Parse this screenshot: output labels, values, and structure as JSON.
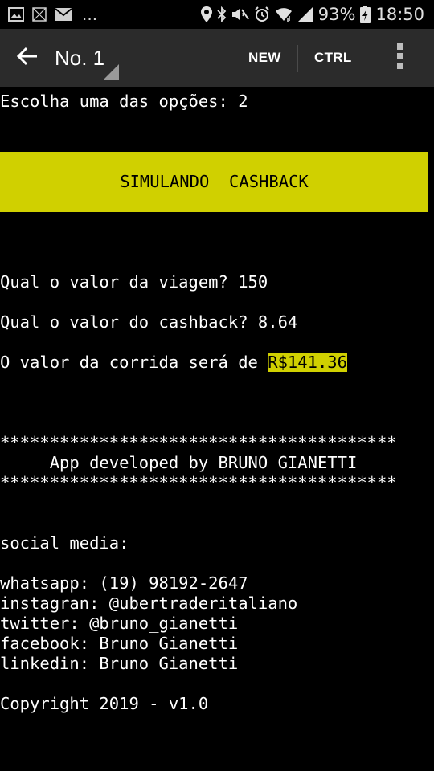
{
  "status_bar": {
    "battery": "93%",
    "time": "18:50",
    "overflow": "...",
    "left_icons": [
      "image-notification-icon",
      "grid-notification-icon",
      "mail-notification-icon"
    ],
    "right_icons": [
      "location-icon",
      "bluetooth-icon",
      "mute-icon",
      "alarm-icon",
      "wifi-icon",
      "signal-icon",
      "battery-charging-icon"
    ]
  },
  "toolbar": {
    "title": "No. 1",
    "new_label": "NEW",
    "ctrl_label": "CTRL",
    "background": "#2b2b2b"
  },
  "terminal": {
    "prompt_line": "Escolha uma das opções: 2",
    "banner": "SIMULANDO  CASHBACK",
    "banner_color": "#d0d000",
    "q_trip": "Qual o valor da viagem? 150",
    "q_cashback": "Qual o valor do cashback? 8.64",
    "result_prefix": "O valor da corrida será de ",
    "result_value": "R$141.36",
    "stars_top": "****************************************",
    "credit": "     App developed by BRUNO GIANETTI",
    "stars_bottom": "****************************************",
    "social_header": "social media:",
    "social": [
      "whatsapp: (19) 98192-2647",
      "instagran: @ubertraderitaliano",
      "twitter: @bruno_gianetti",
      "facebook: Bruno Gianetti",
      "linkedin: Bruno Gianetti"
    ],
    "copyright": "Copyright 2019 - v1.0"
  }
}
